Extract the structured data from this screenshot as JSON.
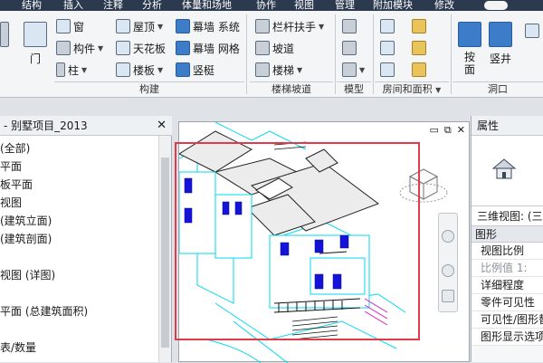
{
  "menubar": {
    "items": [
      "结构",
      "插入",
      "注释",
      "分析",
      "体量和场地",
      "协作",
      "视图",
      "管理",
      "附加模块",
      "修改"
    ]
  },
  "ribbon": {
    "col_door_label": "门",
    "build": {
      "window": "窗",
      "component": "构件",
      "column": "柱",
      "roof": "屋顶",
      "ceiling": "天花板",
      "floor": "楼板",
      "curtain_system": "幕墙 系统",
      "curtain_grid": "幕墙 网格",
      "mullion": "竖梃",
      "group_label": "构建"
    },
    "stair": {
      "railing": "栏杆扶手",
      "ramp": "坡道",
      "stair": "楼梯",
      "group_label": "楼梯坡道"
    },
    "model": {
      "group_label": "模型"
    },
    "room": {
      "group_label": "房间和面积"
    },
    "opening": {
      "by_face": "按\n面",
      "shaft": "竖井",
      "group_label": "洞口"
    }
  },
  "project_browser": {
    "title": "- 别墅项目_2013",
    "items": [
      "(全部)",
      "平面",
      "板平面",
      "视图",
      "(建筑立面)",
      "(建筑剖面)",
      "",
      "视图 (详图)",
      "",
      "平面 (总建筑面积)",
      "",
      "表/数量"
    ]
  },
  "viewport": {
    "controls": [
      "▭",
      "⧉",
      "✕"
    ]
  },
  "properties": {
    "title": "属性",
    "view_selector": "三维视图: (三维",
    "section": "图形",
    "rows": [
      {
        "label": "视图比例",
        "dim": false
      },
      {
        "label": "比例值 1:",
        "dim": true
      },
      {
        "label": "详细程度",
        "dim": false
      },
      {
        "label": "零件可见性",
        "dim": false
      },
      {
        "label": "可见性/图形替",
        "dim": false
      },
      {
        "label": "图形显示选项",
        "dim": false
      }
    ]
  },
  "colors": {
    "highlight_frame": "#e23a4a",
    "model_cyan": "#00e5ff",
    "model_blue": "#1010d0",
    "model_magenta": "#d020c0"
  }
}
